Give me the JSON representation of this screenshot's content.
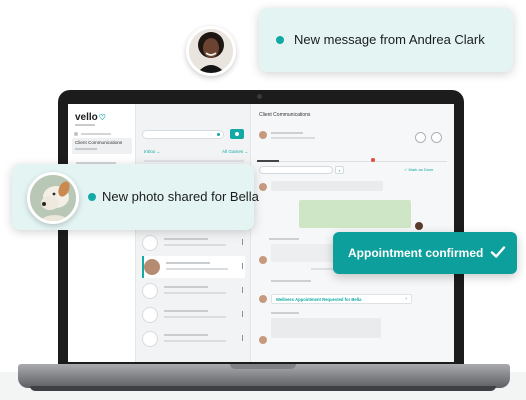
{
  "notifications": {
    "message": {
      "text": "New message from Andrea Clark"
    },
    "photo": {
      "text": "New photo shared for Bella"
    },
    "confirmed": {
      "text": "Appointment confirmed"
    }
  },
  "app": {
    "brand": "vello",
    "sidebar_active": "Client Communications",
    "main_title": "Client Communications",
    "list": {
      "inbox_label": "Inbox",
      "filter_label": "All Games"
    },
    "thread": {
      "mark_done": "Mark as Done",
      "wellness_link": "Wellness Appointment Requested for Bella"
    }
  },
  "colors": {
    "accent": "#13a9a4",
    "confirm_bg": "#0d9f9b",
    "bubble_bg": "#e3f4f3"
  },
  "icons": [
    "heart-icon",
    "search-icon",
    "check-icon",
    "chevron-down-icon",
    "chevron-right-icon",
    "kebab-icon"
  ]
}
